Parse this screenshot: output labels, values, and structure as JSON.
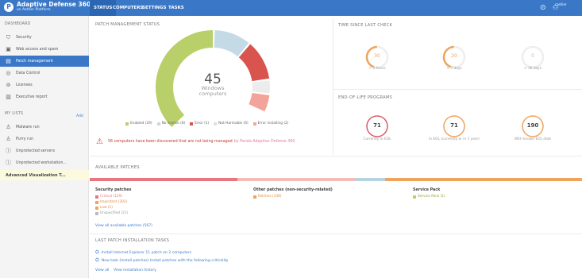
{
  "app": {
    "title": "Adaptive Defense 360",
    "subtitle": "on Aether Platform",
    "logo_letter": "P"
  },
  "nav": {
    "tabs": [
      {
        "label": "STATUS",
        "active": true
      },
      {
        "label": "COMPUTERS"
      },
      {
        "label": "SETTINGS"
      },
      {
        "label": "TASKS"
      }
    ],
    "user": "cashier",
    "help_icon": "help-icon",
    "user_icon": "user-icon"
  },
  "sidebar": {
    "dashboard_header": "DASHBOARD",
    "items": [
      {
        "label": "Security",
        "icon": "shield-icon"
      },
      {
        "label": "Web access and spam",
        "icon": "web-icon"
      },
      {
        "label": "Patch management",
        "icon": "patch-icon",
        "active": true
      },
      {
        "label": "Data Control",
        "icon": "data-control-icon"
      },
      {
        "label": "Licenses",
        "icon": "license-icon"
      },
      {
        "label": "Executive report",
        "icon": "report-icon"
      }
    ],
    "lists_header": "MY LISTS",
    "add_label": "Add",
    "lists": [
      {
        "label": "Malware run",
        "icon": "list-icon"
      },
      {
        "label": "Purry run",
        "icon": "list-icon"
      },
      {
        "label": "Unprotected servers",
        "icon": "info-icon"
      },
      {
        "label": "Unprotected workstation...",
        "icon": "info-icon"
      }
    ],
    "advanced": "Advanced Visualization T..."
  },
  "patch_status": {
    "title": "PATCH MANAGEMENT STATUS",
    "total": "45",
    "total_label_1": "Windows",
    "total_label_2": "computers",
    "legend": [
      {
        "label": "Enabled (29)",
        "color": "#b9cf6a"
      },
      {
        "label": "No license (8)",
        "color": "#c4dbe6"
      },
      {
        "label": "Error (1)",
        "color": "#d9534f"
      },
      {
        "label": "Not-Harmable (6)",
        "color": "#e0e0e0"
      },
      {
        "label": "Error installing (2)",
        "color": "#f2a39a"
      }
    ],
    "alert_text": "56 computers have been discovered that are not being managed",
    "alert_link": "by Panda Adaptive Defense 360"
  },
  "time_since": {
    "title": "TIME SINCE LAST CHECK",
    "rings": [
      {
        "value": "30",
        "label": "< 3 hours",
        "color": "#f0a35c"
      },
      {
        "value": "20",
        "label": "< 7 days",
        "color": "#f0a35c"
      },
      {
        "value": "0",
        "label": "> 30 days",
        "color": "#dddddd"
      }
    ]
  },
  "eol": {
    "title": "END-OF-LIFE PROGRAMS",
    "rings": [
      {
        "value": "71",
        "label": "Currently in EOL",
        "color": "#d85b6a"
      },
      {
        "value": "71",
        "label": "In EOL (currently or in 1 year)",
        "color": "#f0a35c"
      },
      {
        "value": "190",
        "label": "With known EOL date",
        "color": "#f0a35c"
      }
    ]
  },
  "available": {
    "title": "AVAILABLE PATCHES",
    "bar": [
      {
        "value": 0.3,
        "color": "#e8767f"
      },
      {
        "value": 0.24,
        "color": "#f2bcb8"
      },
      {
        "value": 0.06,
        "color": "#b6d4e0"
      },
      {
        "value": 0.4,
        "color": "#f0a35c"
      }
    ],
    "security_title": "Security patches",
    "security_items": [
      {
        "label": "Critical (129)",
        "color": "#e8767f"
      },
      {
        "label": "Important (303)",
        "color": "#f0a35c"
      },
      {
        "label": "Low (1)",
        "color": "#f0a35c"
      },
      {
        "label": "Unspecified (21)",
        "color": "#bbbbbb"
      }
    ],
    "other_title": "Other patches (non-security-related)",
    "other_items": [
      {
        "label": "Patches (236)",
        "color": "#f0a35c"
      }
    ],
    "sp_title": "Service Pack",
    "sp_items": [
      {
        "label": "Service Pack (1)",
        "color": "#b9cf6a"
      }
    ],
    "view_all": "View all available patches (567)"
  },
  "tasks": {
    "title": "LAST PATCH INSTALLATION TASKS",
    "items": [
      "Install Internet Explorer 11 patch on 2 computers",
      "New task (Install patches) Install patches with the following criticality"
    ],
    "view_all": "View all",
    "view_history": "View installation history"
  }
}
